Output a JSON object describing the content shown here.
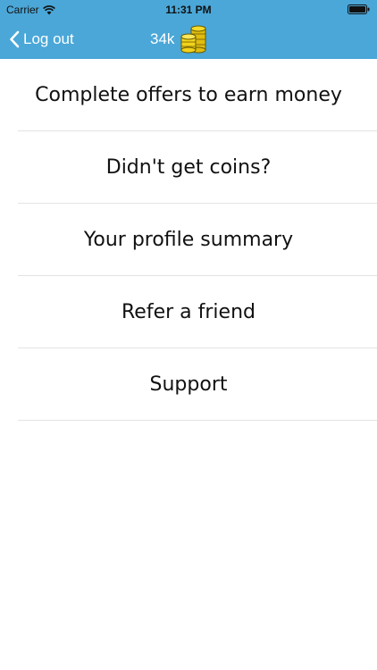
{
  "status_bar": {
    "carrier": "Carrier",
    "time": "11:31 PM",
    "wifi_icon": "wifi-icon",
    "battery_icon": "battery-icon"
  },
  "nav": {
    "back_label": "Log out",
    "back_icon": "chevron-left-icon",
    "coin_count": "34k",
    "coin_icon": "gold-coins-icon"
  },
  "colors": {
    "nav_background": "#4aa7d8",
    "coin_gold": "#f2d31b",
    "separator": "#e3e3e3"
  },
  "menu": {
    "items": [
      {
        "label": "Complete offers to earn money"
      },
      {
        "label": "Didn't get coins?"
      },
      {
        "label": "Your profile summary"
      },
      {
        "label": "Refer a friend"
      },
      {
        "label": "Support"
      }
    ]
  }
}
